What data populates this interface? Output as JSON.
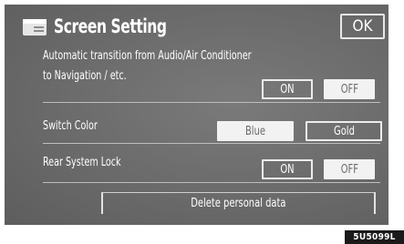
{
  "header": {
    "title": "Screen Setting",
    "icon": "settings-screen-icon",
    "ok_label": "OK"
  },
  "rows": {
    "auto_transition": {
      "label_line1": "Automatic transition from Audio/Air Conditioner",
      "label_line2": "to Navigation / etc.",
      "on_label": "ON",
      "off_label": "OFF",
      "selected": "OFF"
    },
    "switch_color": {
      "label": "Switch Color",
      "blue_label": "Blue",
      "gold_label": "Gold",
      "selected": "Blue"
    },
    "rear_lock": {
      "label": "Rear System Lock",
      "on_label": "ON",
      "off_label": "OFF",
      "selected": "OFF"
    }
  },
  "delete_label": "Delete personal data",
  "figure_code": "5U5099L",
  "colors": {
    "screen_bg": "#6e6e6e",
    "text": "#ffffff",
    "selected_bg": "#f2f2f2"
  }
}
